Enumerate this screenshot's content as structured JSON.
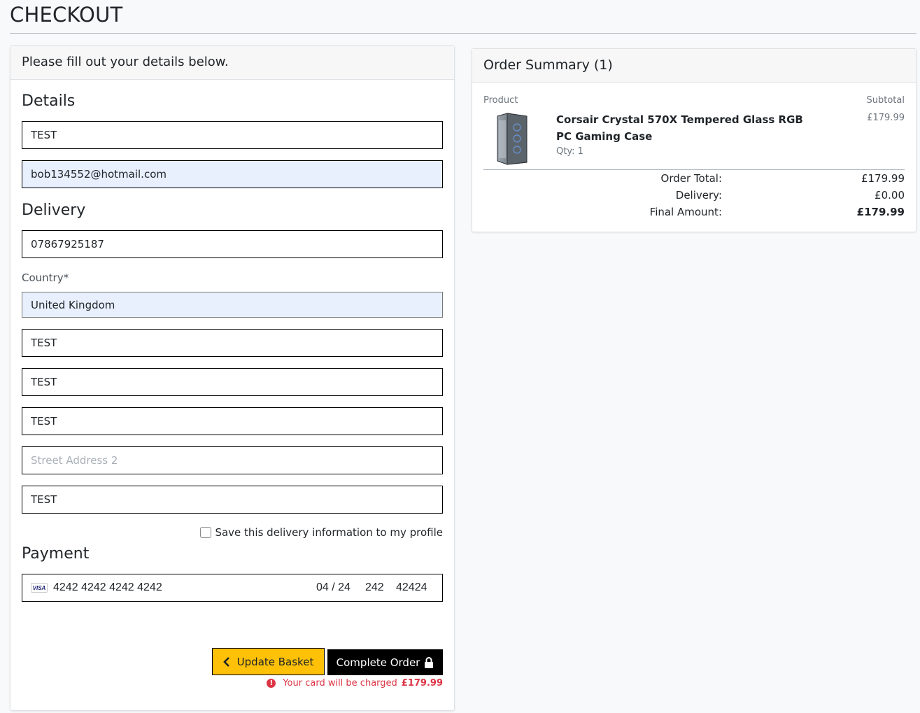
{
  "page": {
    "title": "CHECKOUT"
  },
  "form": {
    "header": "Please fill out your details below.",
    "details_title": "Details",
    "full_name": "TEST",
    "email": "bob134552@hotmail.com",
    "delivery_title": "Delivery",
    "phone": "07867925187",
    "country_label": "Country*",
    "country": "United Kingdom",
    "town": "TEST",
    "postcode": "TEST",
    "street1": "TEST",
    "street2_placeholder": "Street Address 2",
    "county": "TEST",
    "save_label": "Save this delivery information to my profile",
    "payment_title": "Payment",
    "card": {
      "brand": "VISA",
      "number": "4242 4242 4242 4242",
      "expiry": "04 / 24",
      "cvc": "242",
      "zip": "42424"
    },
    "update_button": "Update Basket",
    "complete_button": "Complete Order",
    "charge_note": "Your card will be charged",
    "charge_amount": "£179.99"
  },
  "summary": {
    "header": "Order Summary (1)",
    "col_product": "Product",
    "col_subtotal": "Subtotal",
    "item": {
      "name": "Corsair Crystal 570X Tempered Glass RGB PC Gaming Case",
      "qty": "Qty: 1",
      "subtotal": "£179.99"
    },
    "order_total_label": "Order Total:",
    "order_total": "£179.99",
    "delivery_label": "Delivery:",
    "delivery": "£0.00",
    "final_label": "Final Amount:",
    "final": "£179.99"
  },
  "colors": {
    "accent_yellow": "#ffc107",
    "button_black": "#000000",
    "error_red": "#dc3545",
    "autofill_blue": "#e8f0fe"
  }
}
